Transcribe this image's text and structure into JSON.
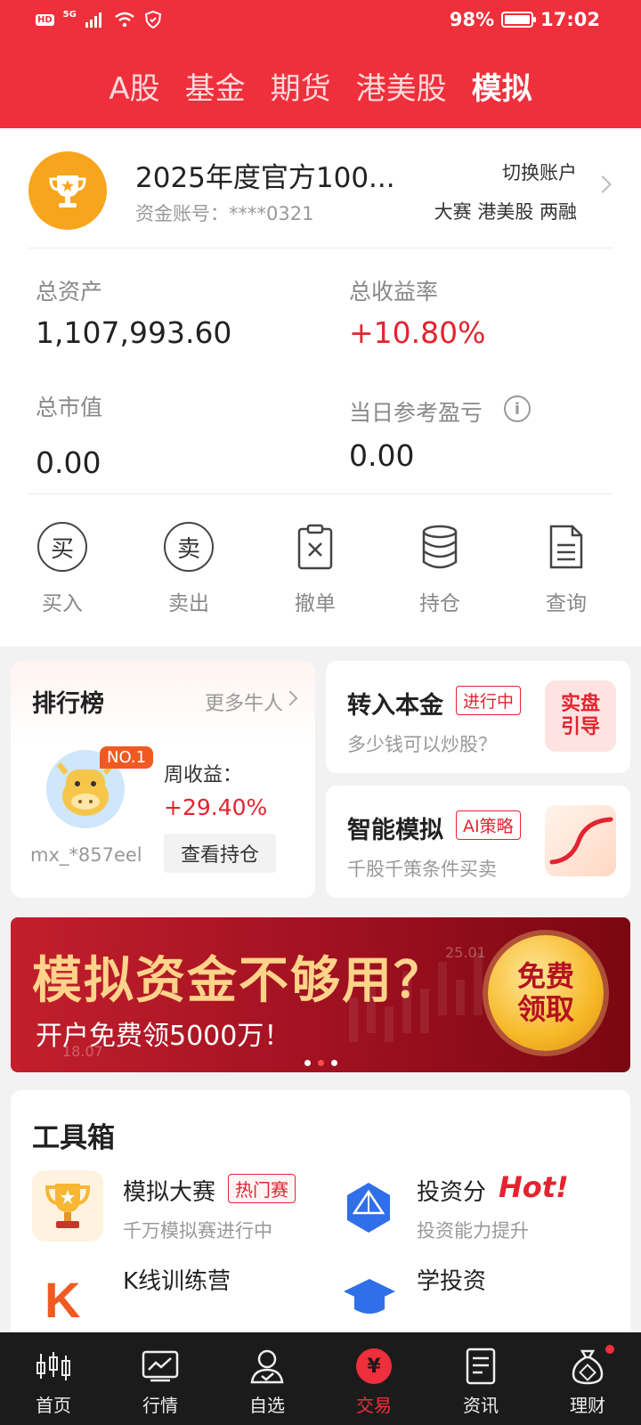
{
  "status_bar": {
    "hd": "HD",
    "net": "5G",
    "battery": "98%",
    "time": "17:02"
  },
  "top_tabs": [
    {
      "label": "A股"
    },
    {
      "label": "基金"
    },
    {
      "label": "期货"
    },
    {
      "label": "港美股"
    },
    {
      "label": "模拟"
    }
  ],
  "account": {
    "name": "2025年度官方100...",
    "account_no": "资金账号：****0321",
    "switch_label": "切换账户",
    "tags": "大赛 港美股 两融",
    "total_assets_label": "总资产",
    "total_assets": "1,107,993.60",
    "total_return_label": "总收益率",
    "total_return": "+10.80%",
    "market_value_label": "总市值",
    "market_value": "0.00",
    "daily_pnl_label": "当日参考盈亏",
    "daily_pnl": "0.00"
  },
  "actions": [
    {
      "label": "买入",
      "glyph": "买"
    },
    {
      "label": "卖出",
      "glyph": "卖"
    },
    {
      "label": "撤单"
    },
    {
      "label": "持仓"
    },
    {
      "label": "查询"
    }
  ],
  "ranking": {
    "title": "排行榜",
    "more": "更多牛人",
    "badge": "NO.1",
    "user": "mx_*857eel",
    "week_label": "周收益：",
    "week_return": "+29.40%",
    "view_button": "查看持仓"
  },
  "promo1": {
    "title": "转入本金",
    "badge": "进行中",
    "sub": "多少钱可以炒股？",
    "thumb_text": "实盘\n引导"
  },
  "promo2": {
    "title": "智能模拟",
    "badge": "AI策略",
    "sub": "千股千策条件买卖"
  },
  "banner": {
    "title": "模拟资金不够用？",
    "sub": "开户免费领5000万！",
    "button": "免费\n领取",
    "chart_label_1": "25.01",
    "chart_label_2": "18.07"
  },
  "toolbox": {
    "title": "工具箱",
    "items": [
      {
        "name": "模拟大赛",
        "badge": "热门赛",
        "sub": "千万模拟赛进行中"
      },
      {
        "name": "投资分",
        "hot": "Hot!",
        "sub": "投资能力提升"
      },
      {
        "name": "K线训练营"
      },
      {
        "name": "学投资"
      }
    ]
  },
  "bottom_nav": [
    {
      "label": "首页"
    },
    {
      "label": "行情"
    },
    {
      "label": "自选"
    },
    {
      "label": "交易"
    },
    {
      "label": "资讯"
    },
    {
      "label": "理财"
    }
  ],
  "colors": {
    "brand_red": "#ef2f3b",
    "gain_red": "#e3242f",
    "trophy_orange": "#f7a51c"
  }
}
